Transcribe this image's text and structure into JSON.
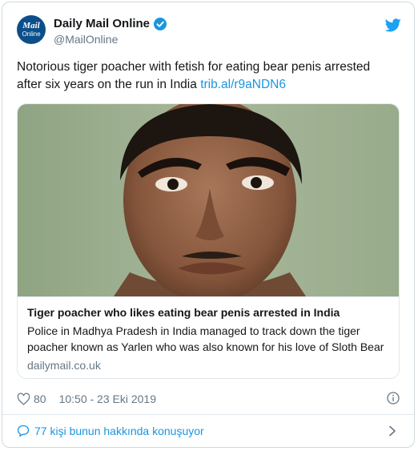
{
  "account": {
    "avatar_line1": "Mail",
    "avatar_line2": "Online",
    "name": "Daily Mail Online",
    "handle": "@MailOnline",
    "verified_icon": "verified-badge-icon",
    "brand_icon": "twitter-bird-icon"
  },
  "tweet": {
    "text": "Notorious tiger poacher with fetish for eating bear penis arrested after six years on the run in India ",
    "link": "trib.al/r9aNDN6"
  },
  "card": {
    "title": "Tiger poacher who likes eating bear penis arrested in India",
    "description": "Police in Madhya Pradesh in India managed to track down the tiger poacher known as Yarlen who was also known for his love of Sloth Bear",
    "domain": "dailymail.co.uk"
  },
  "meta": {
    "likes": "80",
    "timestamp": "10:50 - 23 Eki 2019",
    "like_icon": "heart-icon",
    "info_icon": "info-icon"
  },
  "footer": {
    "conversation": "77 kişi bunun hakkında konuşuyor",
    "icon": "speech-bubble-icon"
  },
  "colors": {
    "link": "#1b95e0",
    "secondary_text": "#657786",
    "avatar_bg": "#0b4f8a"
  }
}
